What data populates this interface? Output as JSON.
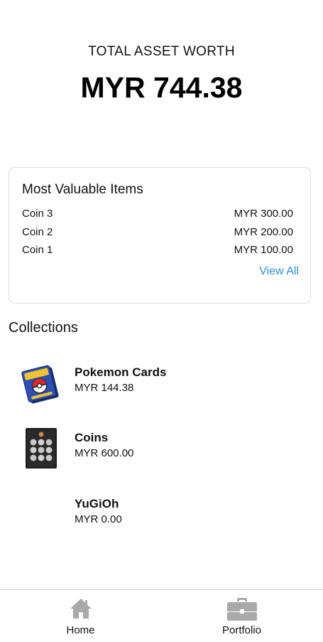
{
  "summary": {
    "total_label": "TOTAL ASSET WORTH",
    "total_value": "MYR 744.38"
  },
  "most_valuable": {
    "title": "Most Valuable Items",
    "items": [
      {
        "name": "Coin 3",
        "value": "MYR 300.00"
      },
      {
        "name": "Coin 2",
        "value": "MYR 200.00"
      },
      {
        "name": "Coin 1",
        "value": "MYR 100.00"
      }
    ],
    "view_all_label": "View All"
  },
  "collections": {
    "title": "Collections",
    "items": [
      {
        "name": "Pokemon Cards",
        "value": "MYR 144.38",
        "icon": "pokemon-cards-deck-image"
      },
      {
        "name": "Coins",
        "value": "MYR 600.00",
        "icon": "coin-album-image"
      },
      {
        "name": "YuGiOh",
        "value": "MYR 0.00",
        "icon": "none"
      }
    ]
  },
  "bottom_nav": {
    "items": [
      {
        "label": "Home",
        "icon": "home-icon"
      },
      {
        "label": "Portfolio",
        "icon": "briefcase-icon"
      }
    ]
  },
  "colors": {
    "accent": "#2b8fd6",
    "icon_gray": "#a9a9a9",
    "border": "#dcdcdc"
  }
}
